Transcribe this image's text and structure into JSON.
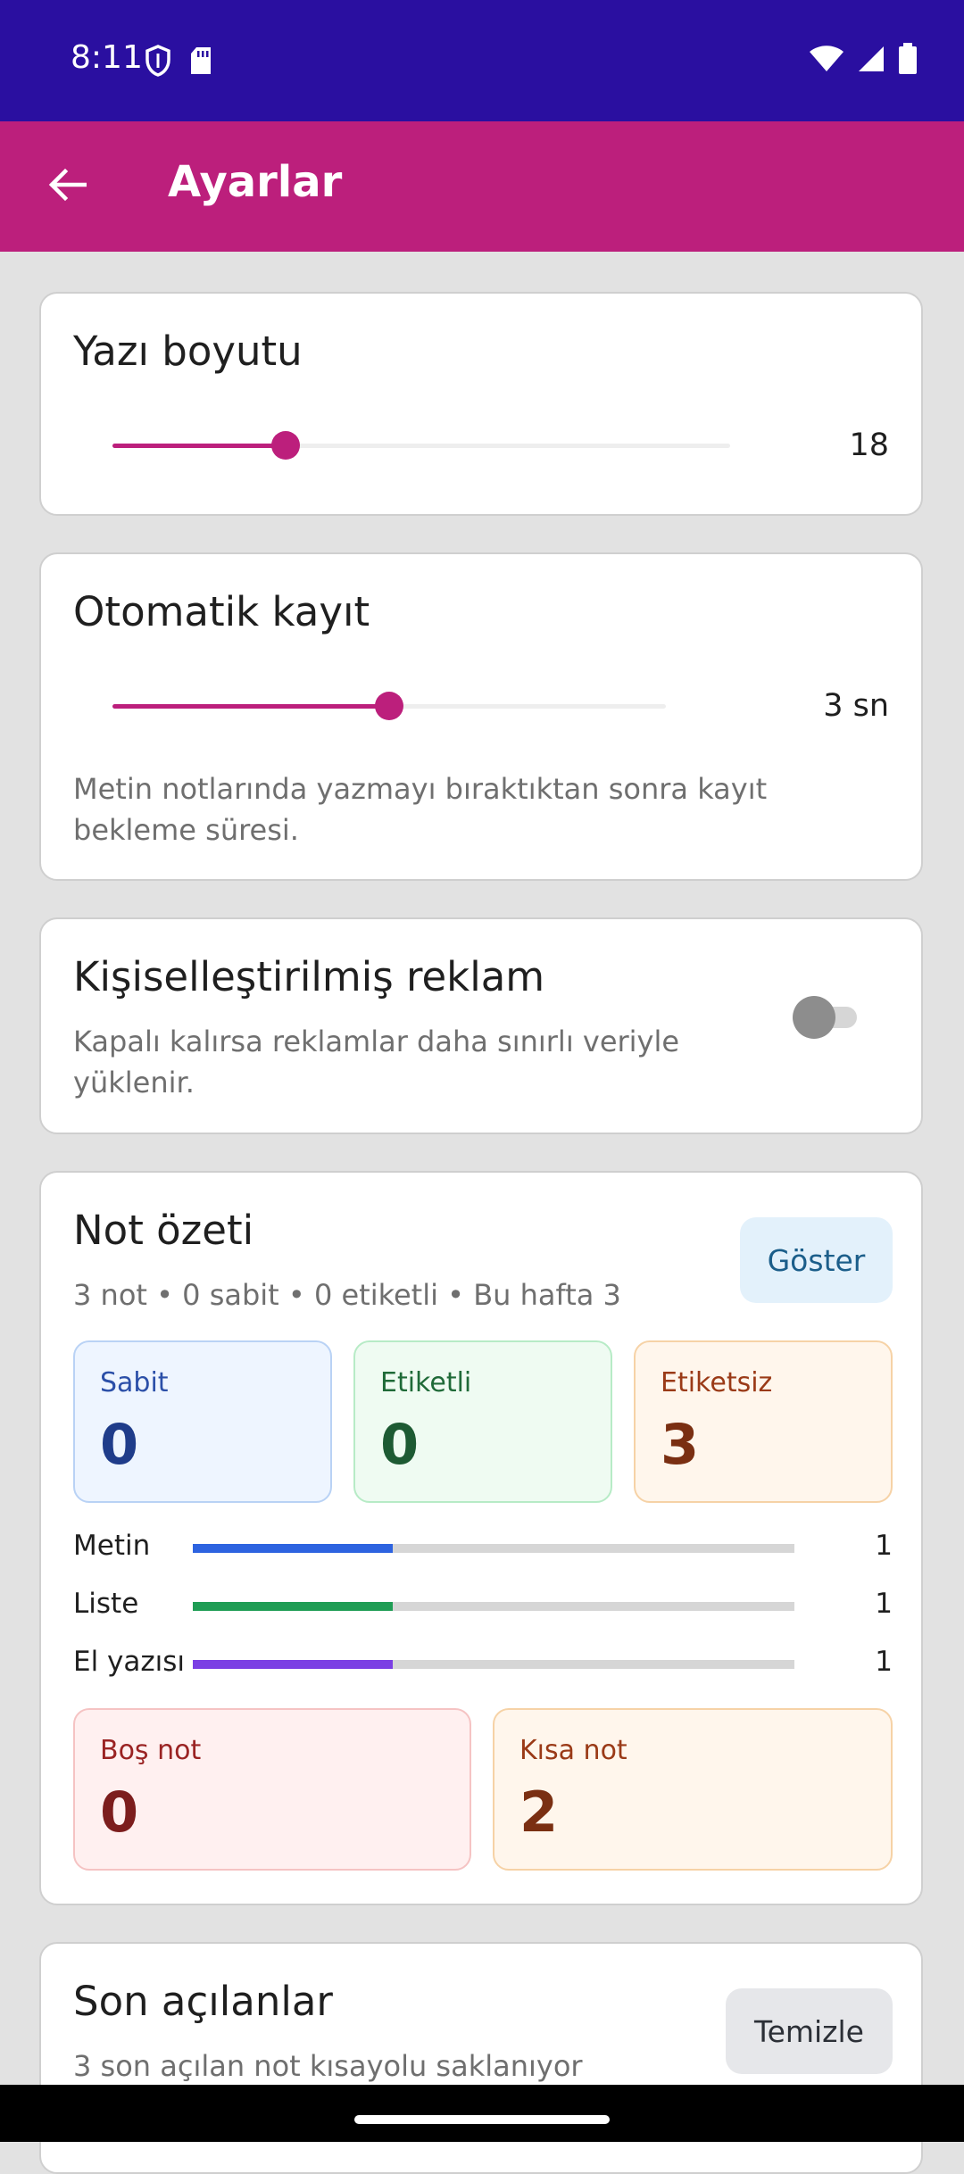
{
  "status": {
    "time": "8:11"
  },
  "appbar": {
    "title": "Ayarlar"
  },
  "font_size": {
    "title": "Yazı boyutu",
    "value_label": "18",
    "slider_fraction": 0.28
  },
  "autosave": {
    "title": "Otomatik kayıt",
    "value_label": "3 sn",
    "slider_fraction": 0.5,
    "help": "Metin notlarında yazmayı bıraktıktan sonra kayıt bekleme süresi."
  },
  "ads": {
    "title": "Kişiselleştirilmiş reklam",
    "help": "Kapalı kalırsa reklamlar daha sınırlı veriyle yüklenir.",
    "enabled": false
  },
  "summary": {
    "title": "Not özeti",
    "subtitle": "3 not • 0 sabit • 0 etiketli • Bu hafta 3",
    "show_button": "Göster",
    "stats": [
      {
        "label": "Sabit",
        "value": "0"
      },
      {
        "label": "Etiketli",
        "value": "0"
      },
      {
        "label": "Etiketsiz",
        "value": "3"
      }
    ],
    "bars": [
      {
        "label": "Metin",
        "count": "1",
        "fraction": 0.333,
        "color": "#2d63e0"
      },
      {
        "label": "Liste",
        "count": "1",
        "fraction": 0.333,
        "color": "#1f9d55"
      },
      {
        "label": "El yazısı",
        "count": "1",
        "fraction": 0.333,
        "color": "#7b3fe4"
      }
    ],
    "extra": [
      {
        "label": "Boş not",
        "value": "0"
      },
      {
        "label": "Kısa not",
        "value": "2"
      }
    ]
  },
  "recent": {
    "title": "Son açılanlar",
    "subtitle": "3 son açılan not kısayolu saklanıyor",
    "clear_button": "Temizle"
  },
  "colors": {
    "status_bar": "#2a0fa0",
    "app_bar": "#bc1f7c",
    "accent": "#bc1f7c"
  }
}
